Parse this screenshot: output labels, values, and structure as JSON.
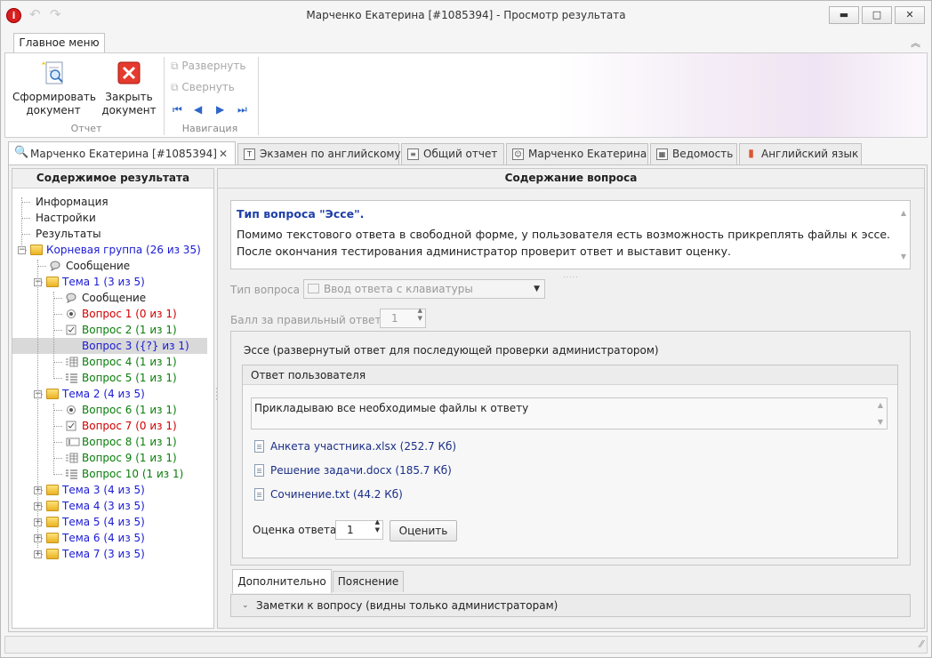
{
  "window": {
    "title": "Марченко Екатерина [#1085394] - Просмотр результата",
    "minimize": "▬",
    "maximize": "□",
    "close": "✕"
  },
  "ribbon": {
    "tab": "Главное меню",
    "generate": "Сформировать документ",
    "close_doc": "Закрыть документ",
    "group_report": "Отчет",
    "expand": "Развернуть",
    "collapse": "Свернуть",
    "group_nav": "Навигация"
  },
  "doc_tabs": [
    {
      "label": "Марченко Екатерина [#1085394]",
      "icon": "search-icon"
    },
    {
      "label": "Экзамен по английскому",
      "icon": "text-icon"
    },
    {
      "label": "Общий отчет",
      "icon": "document-icon"
    },
    {
      "label": "Марченко Екатерина",
      "icon": "user-icon"
    },
    {
      "label": "Ведомость",
      "icon": "sheet-icon"
    },
    {
      "label": "Английский язык",
      "icon": "chart-icon"
    }
  ],
  "left_pane": {
    "header": "Содержимое результата",
    "tree": [
      {
        "label": "Информация",
        "level": 0,
        "color": "#000000"
      },
      {
        "label": "Настройки",
        "level": 0,
        "color": "#000000"
      },
      {
        "label": "Результаты",
        "level": 0,
        "color": "#000000"
      },
      {
        "label": "Корневая группа (26 из 35)",
        "level": 0,
        "color": "blue",
        "folder": true,
        "expanded": true
      },
      {
        "label": "Сообщение",
        "level": 1,
        "color": "#000000",
        "icon": "message-icon"
      },
      {
        "label": "Тема 1 (3 из 5)",
        "level": 1,
        "color": "blue",
        "folder": true,
        "expanded": true
      },
      {
        "label": "Сообщение",
        "level": 2,
        "color": "#000000",
        "icon": "message-icon"
      },
      {
        "label": "Вопрос 1 (0 из 1)",
        "level": 2,
        "color": "red",
        "icon": "radio-icon"
      },
      {
        "label": "Вопрос 2 (1 из 1)",
        "level": 2,
        "color": "green",
        "icon": "checkbox-icon"
      },
      {
        "label": "Вопрос 3 ({?} из 1)",
        "level": 2,
        "color": "blue",
        "icon": "textinput-icon",
        "selected": true
      },
      {
        "label": "Вопрос 4 (1 из 1)",
        "level": 2,
        "color": "green",
        "icon": "matrix-icon"
      },
      {
        "label": "Вопрос 5 (1 из 1)",
        "level": 2,
        "color": "green",
        "icon": "list-icon"
      },
      {
        "label": "Тема 2 (4 из 5)",
        "level": 1,
        "color": "blue",
        "folder": true,
        "expanded": true
      },
      {
        "label": "Вопрос 6 (1 из 1)",
        "level": 2,
        "color": "green",
        "icon": "radio-icon"
      },
      {
        "label": "Вопрос 7 (0 из 1)",
        "level": 2,
        "color": "red",
        "icon": "checkbox-icon"
      },
      {
        "label": "Вопрос 8 (1 из 1)",
        "level": 2,
        "color": "green",
        "icon": "textinput-icon"
      },
      {
        "label": "Вопрос 9 (1 из 1)",
        "level": 2,
        "color": "green",
        "icon": "matrix-icon"
      },
      {
        "label": "Вопрос 10 (1 из 1)",
        "level": 2,
        "color": "green",
        "icon": "list-icon"
      },
      {
        "label": "Тема 3 (4 из 5)",
        "level": 1,
        "color": "blue",
        "folder": true,
        "expanded": false
      },
      {
        "label": "Тема 4 (3 из 5)",
        "level": 1,
        "color": "blue",
        "folder": true,
        "expanded": false
      },
      {
        "label": "Тема 5 (4 из 5)",
        "level": 1,
        "color": "blue",
        "folder": true,
        "expanded": false
      },
      {
        "label": "Тема 6 (4 из 5)",
        "level": 1,
        "color": "blue",
        "folder": true,
        "expanded": false
      },
      {
        "label": "Тема 7 (3 из 5)",
        "level": 1,
        "color": "blue",
        "folder": true,
        "expanded": false
      }
    ]
  },
  "right_pane": {
    "header": "Содержание вопроса",
    "question_type_title": "Тип вопроса \"Эссе\".",
    "question_text": "Помимо текстового ответа в свободной форме, у пользователя есть возможность прикреплять файлы к эссе. После окончания тестирования администратор проверит ответ и выставит оценку.",
    "type_label": "Тип вопроса",
    "type_value": "Ввод ответа с клавиатуры",
    "score_label": "Балл за правильный ответ",
    "score_value": "1",
    "essay_title": "Эссе (развернутый ответ для последующей проверки администратором)",
    "answer_group": "Ответ пользователя",
    "answer_text": "Прикладываю все необходимые файлы к ответу",
    "files": [
      "Анкета участника.xlsx (252.7 Кб)",
      "Решение задачи.docx (185.7 Кб)",
      "Сочинение.txt (44.2 Кб)"
    ],
    "grade_label": "Оценка ответа",
    "grade_value": "1",
    "grade_button": "Оценить",
    "bottom_tabs": [
      "Дополнительно",
      "Пояснение"
    ],
    "notes_label": "Заметки к вопросу (видны только администраторам)"
  },
  "colors": {
    "blue": "#1a1ad4",
    "green": "#0b7d0b",
    "red": "#d10000",
    "accent": "#1f3fa8"
  }
}
